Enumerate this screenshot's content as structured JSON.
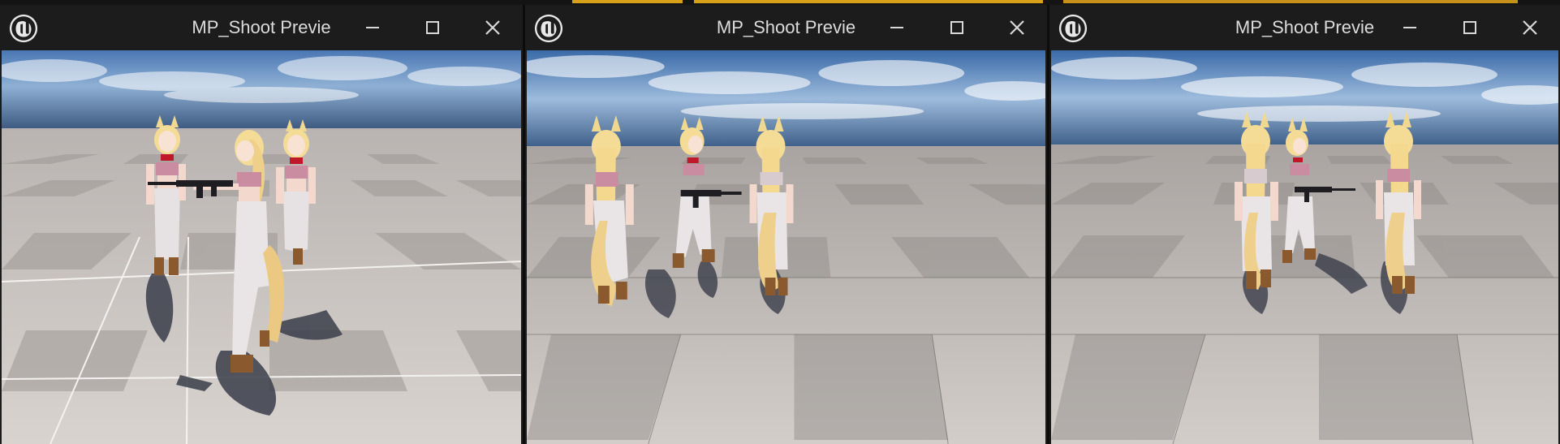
{
  "windows": [
    {
      "title": "MP_Shoot Previe",
      "controls": {
        "minimize_icon": "minimize-icon",
        "maximize_icon": "maximize-icon",
        "close_icon": "close-icon"
      },
      "app_icon": "unreal-engine-logo-icon",
      "viewport": {
        "selected_floor_tile_outline": true,
        "characters": 3
      }
    },
    {
      "title": "MP_Shoot Previe",
      "controls": {
        "minimize_icon": "minimize-icon",
        "maximize_icon": "maximize-icon",
        "close_icon": "close-icon"
      },
      "app_icon": "unreal-engine-logo-icon",
      "viewport": {
        "selected_floor_tile_outline": false,
        "characters": 3
      }
    },
    {
      "title": "MP_Shoot Previe",
      "controls": {
        "minimize_icon": "minimize-icon",
        "maximize_icon": "maximize-icon",
        "close_icon": "close-icon"
      },
      "app_icon": "unreal-engine-logo-icon",
      "viewport": {
        "selected_floor_tile_outline": false,
        "characters": 3
      }
    }
  ],
  "colors": {
    "titlebar_bg": "#1c1c1c",
    "title_text": "#dcdcdc",
    "sky_top": "#3e6aa6",
    "floor_light": "#cfcac6",
    "floor_dark": "#a7a29f",
    "taskbar_accent": "#d8a11a"
  }
}
